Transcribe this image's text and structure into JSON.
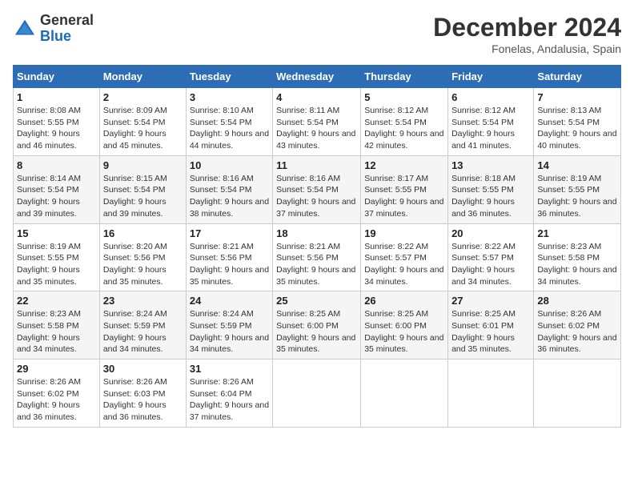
{
  "logo": {
    "general": "General",
    "blue": "Blue"
  },
  "title": "December 2024",
  "location": "Fonelas, Andalusia, Spain",
  "headers": [
    "Sunday",
    "Monday",
    "Tuesday",
    "Wednesday",
    "Thursday",
    "Friday",
    "Saturday"
  ],
  "weeks": [
    [
      {
        "day": "1",
        "sunrise": "8:08 AM",
        "sunset": "5:55 PM",
        "daylight": "9 hours and 46 minutes."
      },
      {
        "day": "2",
        "sunrise": "8:09 AM",
        "sunset": "5:54 PM",
        "daylight": "9 hours and 45 minutes."
      },
      {
        "day": "3",
        "sunrise": "8:10 AM",
        "sunset": "5:54 PM",
        "daylight": "9 hours and 44 minutes."
      },
      {
        "day": "4",
        "sunrise": "8:11 AM",
        "sunset": "5:54 PM",
        "daylight": "9 hours and 43 minutes."
      },
      {
        "day": "5",
        "sunrise": "8:12 AM",
        "sunset": "5:54 PM",
        "daylight": "9 hours and 42 minutes."
      },
      {
        "day": "6",
        "sunrise": "8:12 AM",
        "sunset": "5:54 PM",
        "daylight": "9 hours and 41 minutes."
      },
      {
        "day": "7",
        "sunrise": "8:13 AM",
        "sunset": "5:54 PM",
        "daylight": "9 hours and 40 minutes."
      }
    ],
    [
      {
        "day": "8",
        "sunrise": "8:14 AM",
        "sunset": "5:54 PM",
        "daylight": "9 hours and 39 minutes."
      },
      {
        "day": "9",
        "sunrise": "8:15 AM",
        "sunset": "5:54 PM",
        "daylight": "9 hours and 39 minutes."
      },
      {
        "day": "10",
        "sunrise": "8:16 AM",
        "sunset": "5:54 PM",
        "daylight": "9 hours and 38 minutes."
      },
      {
        "day": "11",
        "sunrise": "8:16 AM",
        "sunset": "5:54 PM",
        "daylight": "9 hours and 37 minutes."
      },
      {
        "day": "12",
        "sunrise": "8:17 AM",
        "sunset": "5:55 PM",
        "daylight": "9 hours and 37 minutes."
      },
      {
        "day": "13",
        "sunrise": "8:18 AM",
        "sunset": "5:55 PM",
        "daylight": "9 hours and 36 minutes."
      },
      {
        "day": "14",
        "sunrise": "8:19 AM",
        "sunset": "5:55 PM",
        "daylight": "9 hours and 36 minutes."
      }
    ],
    [
      {
        "day": "15",
        "sunrise": "8:19 AM",
        "sunset": "5:55 PM",
        "daylight": "9 hours and 35 minutes."
      },
      {
        "day": "16",
        "sunrise": "8:20 AM",
        "sunset": "5:56 PM",
        "daylight": "9 hours and 35 minutes."
      },
      {
        "day": "17",
        "sunrise": "8:21 AM",
        "sunset": "5:56 PM",
        "daylight": "9 hours and 35 minutes."
      },
      {
        "day": "18",
        "sunrise": "8:21 AM",
        "sunset": "5:56 PM",
        "daylight": "9 hours and 35 minutes."
      },
      {
        "day": "19",
        "sunrise": "8:22 AM",
        "sunset": "5:57 PM",
        "daylight": "9 hours and 34 minutes."
      },
      {
        "day": "20",
        "sunrise": "8:22 AM",
        "sunset": "5:57 PM",
        "daylight": "9 hours and 34 minutes."
      },
      {
        "day": "21",
        "sunrise": "8:23 AM",
        "sunset": "5:58 PM",
        "daylight": "9 hours and 34 minutes."
      }
    ],
    [
      {
        "day": "22",
        "sunrise": "8:23 AM",
        "sunset": "5:58 PM",
        "daylight": "9 hours and 34 minutes."
      },
      {
        "day": "23",
        "sunrise": "8:24 AM",
        "sunset": "5:59 PM",
        "daylight": "9 hours and 34 minutes."
      },
      {
        "day": "24",
        "sunrise": "8:24 AM",
        "sunset": "5:59 PM",
        "daylight": "9 hours and 34 minutes."
      },
      {
        "day": "25",
        "sunrise": "8:25 AM",
        "sunset": "6:00 PM",
        "daylight": "9 hours and 35 minutes."
      },
      {
        "day": "26",
        "sunrise": "8:25 AM",
        "sunset": "6:00 PM",
        "daylight": "9 hours and 35 minutes."
      },
      {
        "day": "27",
        "sunrise": "8:25 AM",
        "sunset": "6:01 PM",
        "daylight": "9 hours and 35 minutes."
      },
      {
        "day": "28",
        "sunrise": "8:26 AM",
        "sunset": "6:02 PM",
        "daylight": "9 hours and 36 minutes."
      }
    ],
    [
      {
        "day": "29",
        "sunrise": "8:26 AM",
        "sunset": "6:02 PM",
        "daylight": "9 hours and 36 minutes."
      },
      {
        "day": "30",
        "sunrise": "8:26 AM",
        "sunset": "6:03 PM",
        "daylight": "9 hours and 36 minutes."
      },
      {
        "day": "31",
        "sunrise": "8:26 AM",
        "sunset": "6:04 PM",
        "daylight": "9 hours and 37 minutes."
      },
      null,
      null,
      null,
      null
    ]
  ]
}
